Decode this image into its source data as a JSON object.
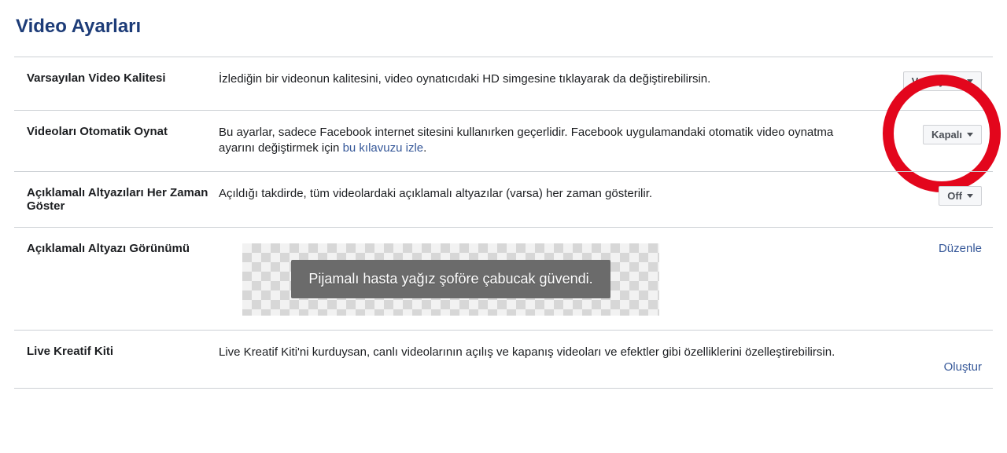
{
  "title": "Video Ayarları",
  "rows": {
    "quality": {
      "label": "Varsayılan Video Kalitesi",
      "desc": "İzlediğin bir videonun kalitesini, video oynatıcıdaki HD simgesine tıklayarak da değiştirebilirsin.",
      "value": "Varsayılan"
    },
    "autoplay": {
      "label": "Videoları Otomatik Oynat",
      "desc_pre": "Bu ayarlar, sadece Facebook internet sitesini kullanırken geçerlidir. Facebook uygulamandaki otomatik video oynatma ayarını değiştirmek için ",
      "desc_link": "bu kılavuzu izle",
      "desc_post": ".",
      "value": "Kapalı"
    },
    "captions_always": {
      "label": "Açıklamalı Altyazıları Her Zaman Göster",
      "desc": "Açıldığı takdirde, tüm videolardaki açıklamalı altyazılar (varsa) her zaman gösterilir.",
      "value": "Off"
    },
    "caption_look": {
      "label": "Açıklamalı Altyazı Görünümü",
      "sample": "Pijamalı hasta yağız şoföre çabucak güvendi.",
      "action": "Düzenle"
    },
    "live_kit": {
      "label": "Live Kreatif Kiti",
      "desc": "Live Kreatif Kiti'ni kurduysan, canlı videolarının açılış ve kapanış videoları ve efektler gibi özelliklerini özelleştirebilirsin.",
      "action": "Oluştur"
    }
  }
}
